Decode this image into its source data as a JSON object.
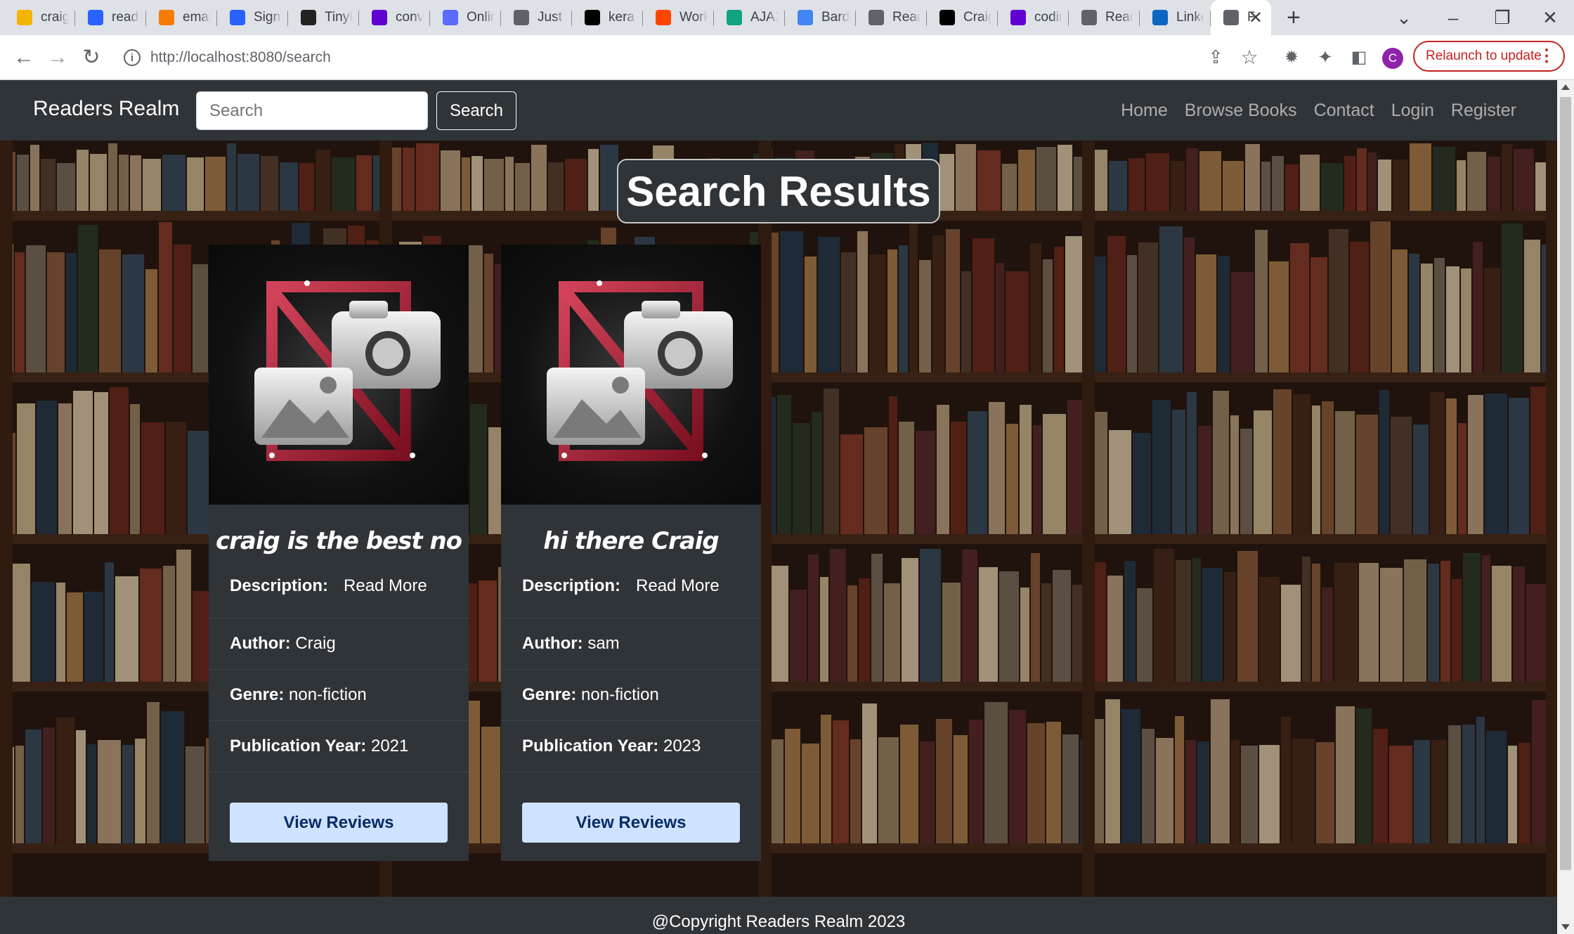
{
  "browser": {
    "tabs": [
      {
        "label": "craig",
        "icon": "g-icon",
        "color": "#f4b400"
      },
      {
        "label": "reade",
        "icon": "shield-icon",
        "color": "#2962ff"
      },
      {
        "label": "email",
        "icon": "shield-icon",
        "color": "#f57c00"
      },
      {
        "label": "Sign",
        "icon": "shield-icon",
        "color": "#2962ff"
      },
      {
        "label": "TinyP",
        "icon": "panda-icon",
        "color": "#222222"
      },
      {
        "label": "conv",
        "icon": "y-icon",
        "color": "#6001d2"
      },
      {
        "label": "Onlin",
        "icon": "circle-icon",
        "color": "#5b6bff"
      },
      {
        "label": "Just a",
        "icon": "globe-icon",
        "color": "#5f6368"
      },
      {
        "label": "kera",
        "icon": "github-icon",
        "color": "#000000"
      },
      {
        "label": "Work",
        "icon": "ring-icon",
        "color": "#ff4500"
      },
      {
        "label": "AJAX",
        "icon": "openai-icon",
        "color": "#10a37f"
      },
      {
        "label": "Bard",
        "icon": "sparkle-icon",
        "color": "#4285f4"
      },
      {
        "label": "Read",
        "icon": "globe-icon",
        "color": "#5f6368"
      },
      {
        "label": "Craig",
        "icon": "github-icon",
        "color": "#000000"
      },
      {
        "label": "codir",
        "icon": "y-icon",
        "color": "#6001d2"
      },
      {
        "label": "Read",
        "icon": "globe-icon",
        "color": "#5f6368"
      },
      {
        "label": "Linke",
        "icon": "linkedin-icon",
        "color": "#0a66c2"
      },
      {
        "label": "F",
        "icon": "globe-icon",
        "color": "#5f6368",
        "active": true
      }
    ],
    "new_tab": "+",
    "url": "http://localhost:8080/search",
    "relaunch": "Relaunch to update",
    "avatar_letter": "C"
  },
  "navbar": {
    "brand": "Readers Realm",
    "search_placeholder": "Search",
    "search_button": "Search",
    "links": [
      "Home",
      "Browse Books",
      "Contact",
      "Login",
      "Register"
    ]
  },
  "page_title": "Search Results",
  "labels": {
    "description": "Description:",
    "read_more": "Read More",
    "author": "Author:",
    "genre": "Genre:",
    "year": "Publication Year:",
    "view_reviews": "View Reviews"
  },
  "books": [
    {
      "title": "craig is the best no",
      "author": "Craig",
      "genre": "non-fiction",
      "year": "2021"
    },
    {
      "title": "hi there Craig",
      "author": "sam",
      "genre": "non-fiction",
      "year": "2023"
    }
  ],
  "footer": "@Copyright Readers Realm 2023"
}
